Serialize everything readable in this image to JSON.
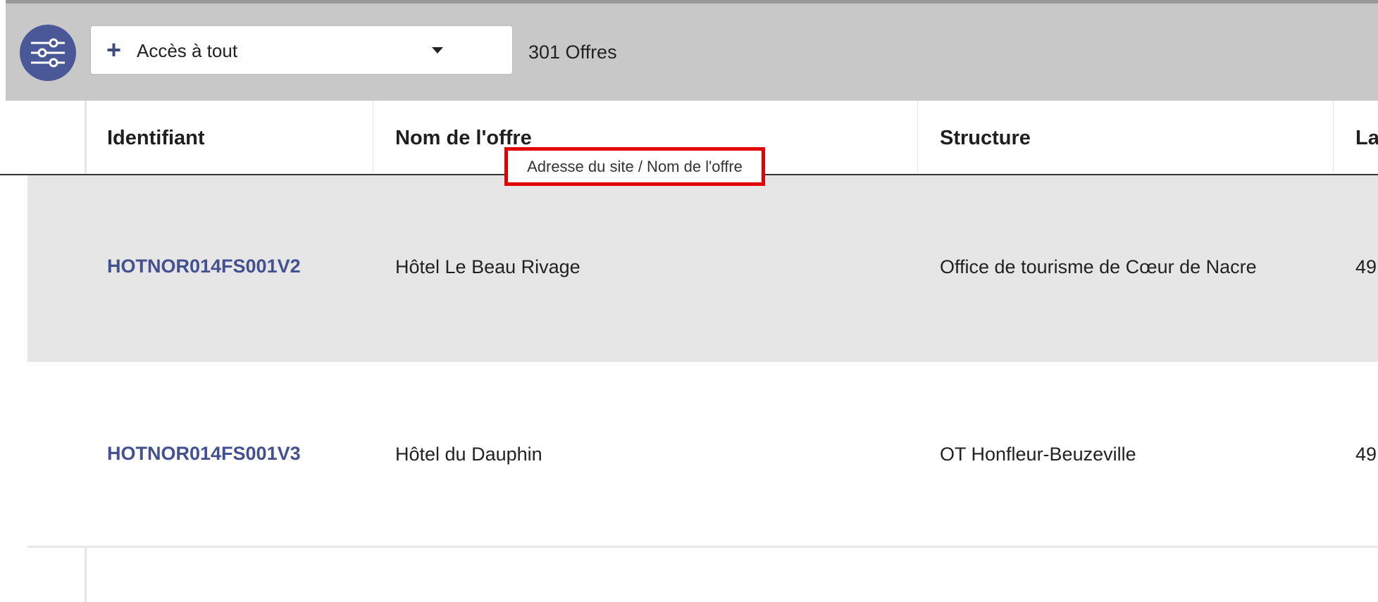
{
  "toolbar": {
    "filter_icon": "sliders-icon",
    "access_label": "Accès à tout",
    "count_text": "301 Offres",
    "accent_color": "#4a5898"
  },
  "table": {
    "columns": [
      "Identifiant",
      "Nom de l'offre",
      "Structure",
      "La"
    ],
    "rows": [
      {
        "id": "HOTNOR014FS001V2",
        "name": "Hôtel Le Beau Rivage",
        "structure": "Office de tourisme de Cœur de Nacre",
        "extra": "49"
      },
      {
        "id": "HOTNOR014FS001V3",
        "name": "Hôtel du Dauphin",
        "structure": "OT Honfleur-Beuzeville",
        "extra": "49"
      }
    ]
  },
  "tooltip": {
    "text": "Adresse du site / Nom de l'offre"
  }
}
